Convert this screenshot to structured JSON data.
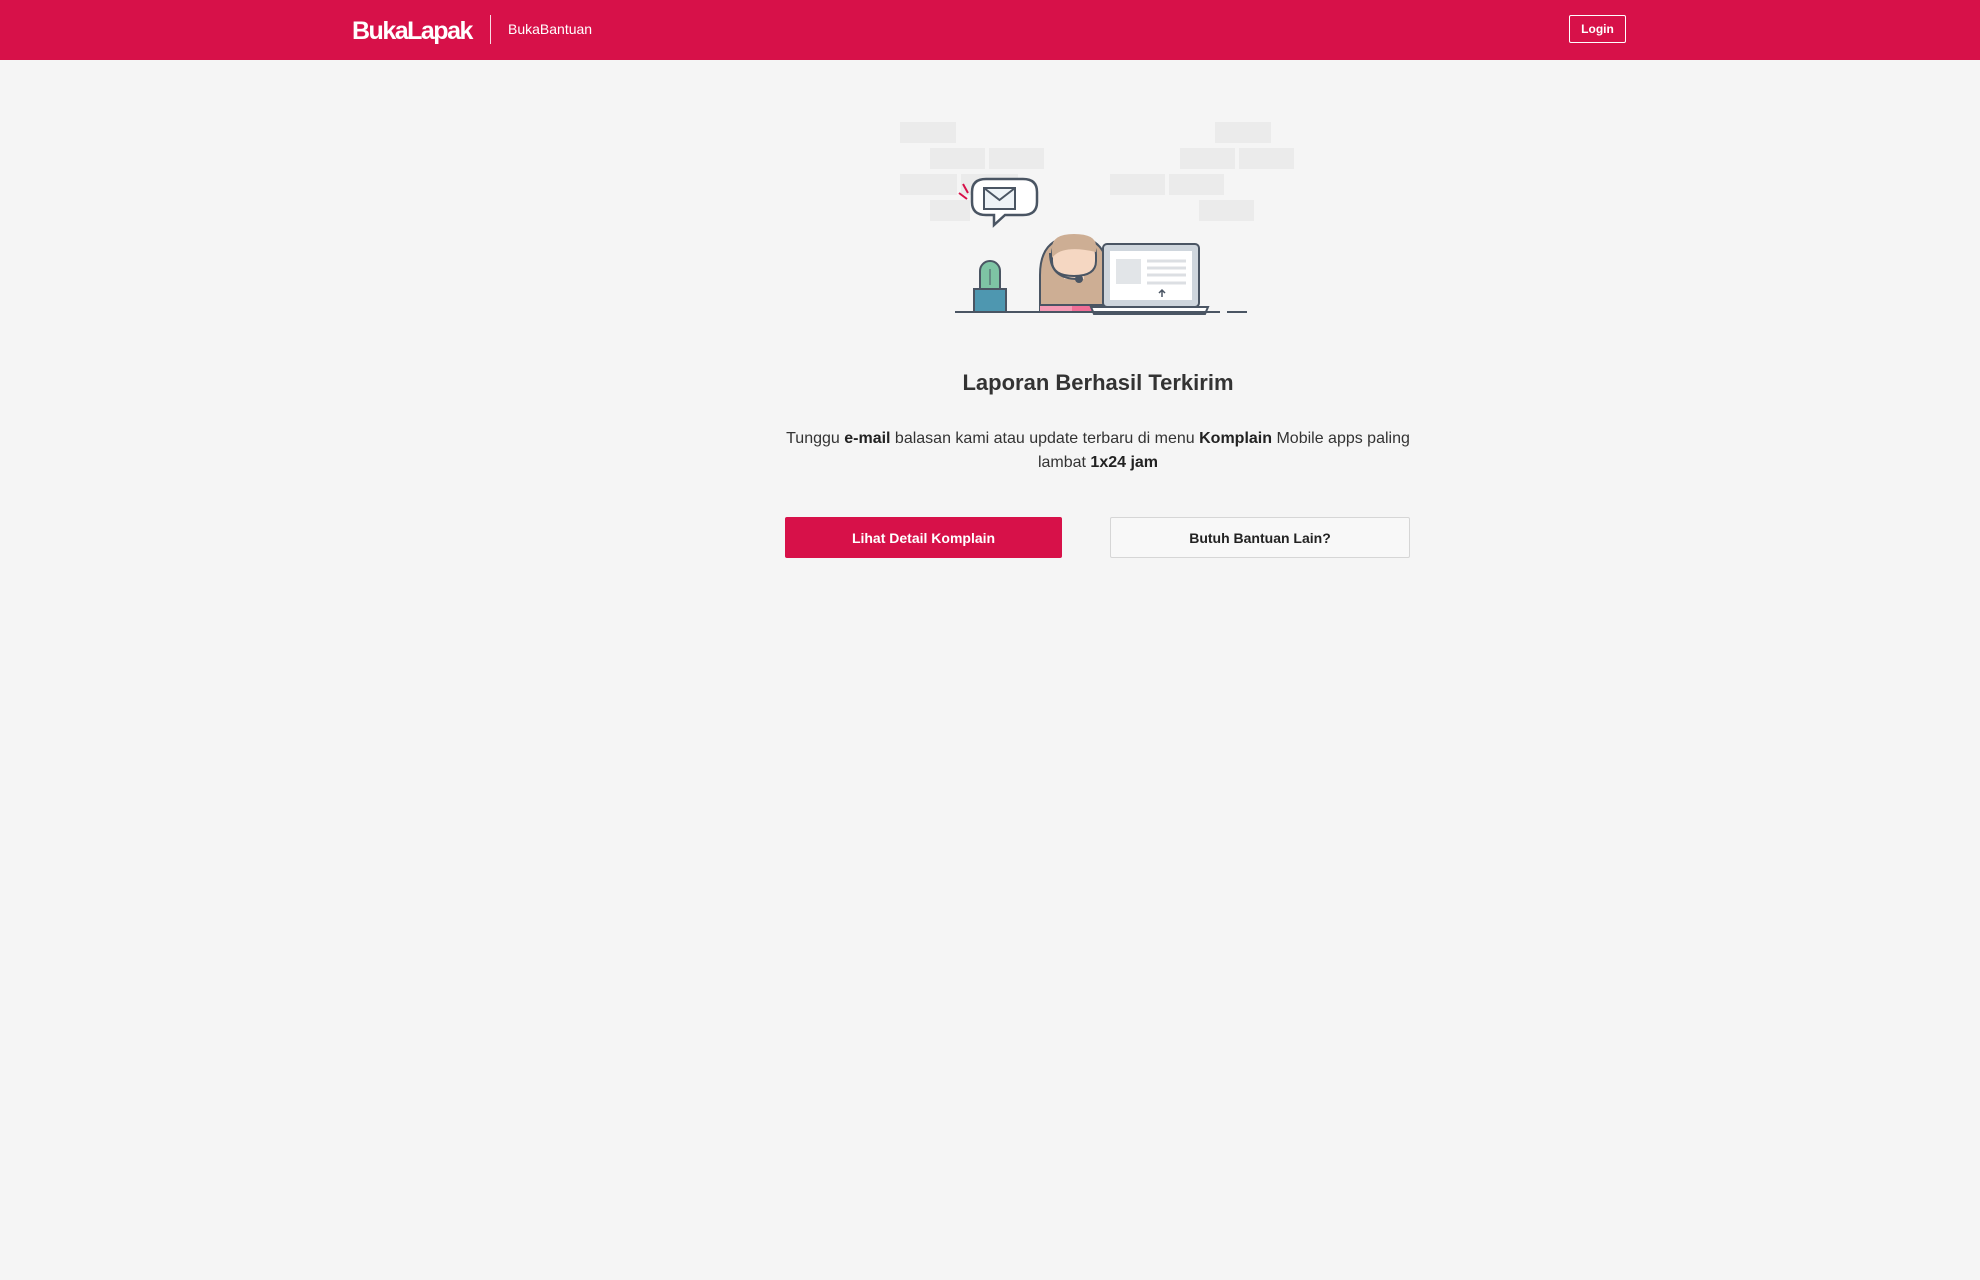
{
  "header": {
    "logo_text": "BukaLapak",
    "section_title": "BukaBantuan",
    "login_label": "Login",
    "brand_color": "#d71149"
  },
  "main": {
    "illustration_icon": "customer-support-illustration",
    "title": "Laporan Berhasil Terkirim",
    "message": {
      "part1": "Tunggu ",
      "bold1": "e-mail",
      "part2": " balasan kami atau update terbaru di menu ",
      "bold2": "Komplain",
      "part3": " Mobile apps paling lambat ",
      "bold3": "1x24 jam"
    },
    "primary_button_label": "Lihat Detail Komplain",
    "secondary_button_label": "Butuh Bantuan Lain?"
  }
}
